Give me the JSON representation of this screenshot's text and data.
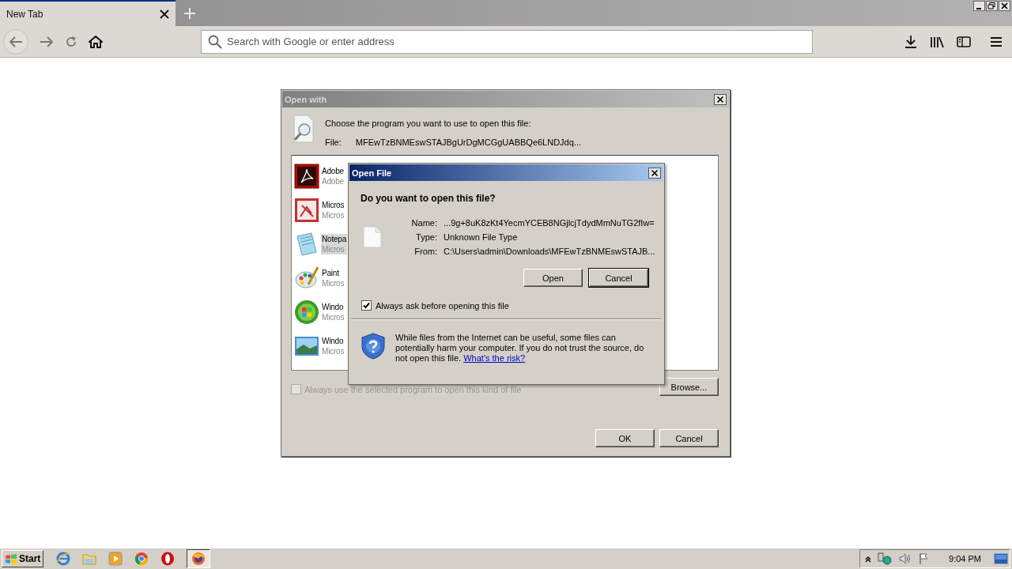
{
  "browser": {
    "tabs": [
      {
        "label": "New Tab",
        "selected": true
      }
    ],
    "address": {
      "placeholder": "Search with Google or enter address"
    }
  },
  "open_with": {
    "title": "Open with",
    "prompt": "Choose the program you want to use to open this file:",
    "file_label": "File:",
    "file_name": "MFEwTzBNMEswSTAJBgUrDgMCGgUABBQe6LNDJdq...",
    "programs": [
      {
        "kind": "pdf",
        "name": "Adobe",
        "publisher": "Adobe",
        "selected": false
      },
      {
        "kind": "draw",
        "name": "Micros",
        "publisher": "Micros",
        "selected": false
      },
      {
        "kind": "notepad",
        "name": "Notepa",
        "publisher": "Micros",
        "selected": true
      },
      {
        "kind": "paint",
        "name": "Paint",
        "publisher": "Micros",
        "selected": false
      },
      {
        "kind": "windows",
        "name": "Windo",
        "publisher": "Micros",
        "selected": false
      },
      {
        "kind": "photo",
        "name": "Windo",
        "publisher": "Micros",
        "selected": false
      }
    ],
    "always_use": {
      "label": "Always use the selected program to open this kind of file",
      "checked": false,
      "disabled": true
    },
    "browse": "Browse...",
    "buttons": [
      {
        "label": "OK",
        "default": false
      },
      {
        "label": "Cancel",
        "default": false
      }
    ]
  },
  "open_file": {
    "title": "Open File",
    "question": "Do you want to open this file?",
    "fields": [
      {
        "label": "Name:",
        "value": "...9g+8uK8zKt4YecmYCEB8NGjlcjTdydMmNuTG2fIw="
      },
      {
        "label": "Type:",
        "value": "Unknown File Type"
      },
      {
        "label": "From:",
        "value": "C:\\Users\\admin\\Downloads\\MFEwTzBNMEswSTAJB..."
      }
    ],
    "buttons": [
      {
        "label": "Open",
        "default": false
      },
      {
        "label": "Cancel",
        "default": true
      }
    ],
    "always_ask": {
      "label": "Always ask before opening this file",
      "checked": true
    },
    "warning": {
      "text": "While files from the Internet can be useful, some files can potentially harm your computer. If you do not trust the source, do not open this file.",
      "link": "What's the risk?"
    }
  },
  "taskbar": {
    "start": "Start",
    "apps": [
      {
        "kind": "ie",
        "active": false
      },
      {
        "kind": "folder",
        "active": false
      },
      {
        "kind": "media",
        "active": false
      },
      {
        "kind": "chrome",
        "active": false
      },
      {
        "kind": "opera",
        "active": false
      },
      {
        "kind": "firefox",
        "active": true
      }
    ],
    "clock": "9:04 PM"
  }
}
